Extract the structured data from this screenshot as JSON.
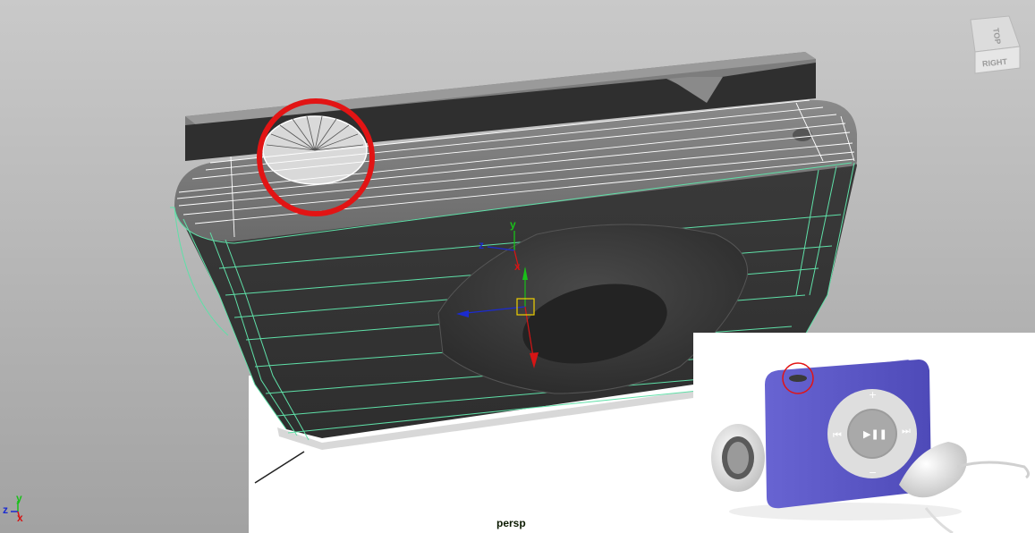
{
  "viewport": {
    "camera_label": "persp",
    "view_cube": {
      "top_label": "TOP",
      "right_label": "RIGHT"
    }
  },
  "manipulator": {
    "y_label": "y",
    "z_label": "z",
    "x_label": "x"
  },
  "origin_axes": {
    "y_label": "y",
    "z_label": "z",
    "x_label": "x"
  },
  "reference_image": {
    "device": "ipod-shuffle",
    "wheel_icons": {
      "plus": "+",
      "minus": "−",
      "play_pause": "▶❚❚",
      "previous": "⏮",
      "next": "⏭"
    }
  },
  "colors": {
    "wireframe": "#5fe0a8",
    "highlight_circle": "#e21414",
    "axis_x": "#d61515",
    "axis_y": "#19c019",
    "axis_z": "#1b2bd0",
    "ipod_body": "#5b57c8"
  }
}
